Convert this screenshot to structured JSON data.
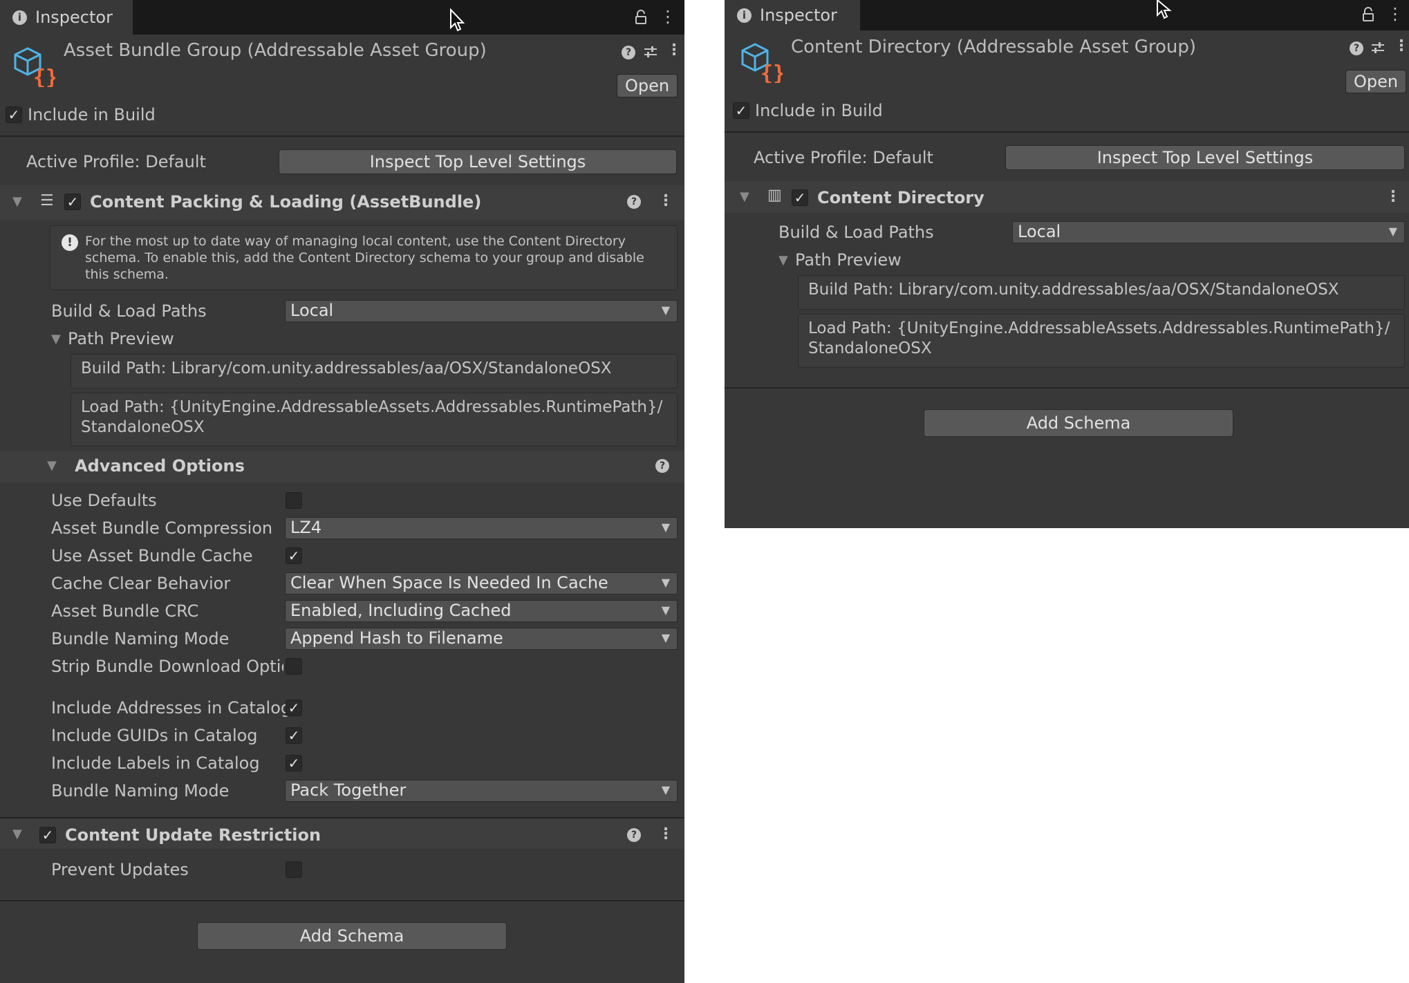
{
  "left": {
    "tab_title": "Inspector",
    "header_title": "Asset Bundle Group (Addressable Asset Group)",
    "open_label": "Open",
    "include_in_build": {
      "label": "Include in Build",
      "checked": true
    },
    "active_profile": "Active Profile: Default",
    "inspect_button": "Inspect Top Level Settings",
    "packing": {
      "title": "Content Packing & Loading (AssetBundle)",
      "enabled": true,
      "help_text": "For the most up to date way of managing local content, use the Content Directory schema. To enable this, add the Content Directory schema to your group and disable this schema.",
      "build_load_label": "Build & Load Paths",
      "build_load_value": "Local",
      "path_preview_label": "Path Preview",
      "build_path": "Build Path: Library/com.unity.addressables/aa/OSX/StandaloneOSX",
      "load_path": "Load Path: {UnityEngine.AddressableAssets.Addressables.RuntimePath}/ StandaloneOSX"
    },
    "advanced": {
      "title": "Advanced Options",
      "use_defaults": {
        "label": "Use Defaults",
        "checked": false
      },
      "compression": {
        "label": "Asset Bundle Compression",
        "value": "LZ4"
      },
      "use_cache": {
        "label": "Use Asset Bundle Cache",
        "checked": true
      },
      "cache_clear": {
        "label": "Cache Clear Behavior",
        "value": "Clear When Space Is Needed In Cache"
      },
      "crc": {
        "label": "Asset Bundle CRC",
        "value": "Enabled, Including Cached"
      },
      "naming": {
        "label": "Bundle Naming Mode",
        "value": "Append Hash to Filename"
      },
      "strip": {
        "label": "Strip Bundle Download Options",
        "checked": false
      },
      "include_addresses": {
        "label": "Include Addresses in Catalog",
        "checked": true
      },
      "include_guids": {
        "label": "Include GUIDs in Catalog",
        "checked": true
      },
      "include_labels": {
        "label": "Include Labels in Catalog",
        "checked": true
      },
      "naming2": {
        "label": "Bundle Naming Mode",
        "value": "Pack Together"
      }
    },
    "restriction": {
      "title": "Content Update Restriction",
      "enabled": true,
      "prevent_updates": {
        "label": "Prevent Updates",
        "checked": false
      }
    },
    "add_schema": "Add Schema"
  },
  "right": {
    "tab_title": "Inspector",
    "header_title": "Content Directory (Addressable Asset Group)",
    "open_label": "Open",
    "include_in_build": {
      "label": "Include in Build",
      "checked": true
    },
    "active_profile": "Active Profile: Default",
    "inspect_button": "Inspect Top Level Settings",
    "content_directory": {
      "title": "Content Directory",
      "enabled": true,
      "build_load_label": "Build & Load Paths",
      "build_load_value": "Local",
      "path_preview_label": "Path Preview",
      "build_path": "Build Path: Library/com.unity.addressables/aa/OSX/StandaloneOSX",
      "load_path": "Load Path: {UnityEngine.AddressableAssets.Addressables.RuntimePath}/ StandaloneOSX"
    },
    "add_schema": "Add Schema"
  },
  "icons": {
    "info": "info-icon",
    "lock": "lock-icon",
    "kebab": "kebab-menu-icon",
    "help": "help-icon",
    "presets": "sliders-icon",
    "asset_group": "addressable-group-icon",
    "schema": "schema-icon"
  },
  "colors": {
    "panel_bg": "#383838",
    "tab_bar_bg": "#191919",
    "button_bg": "#585858",
    "field_bg": "#515151",
    "icon_blue": "#4fb3e6",
    "icon_orange": "#f26b3a"
  }
}
